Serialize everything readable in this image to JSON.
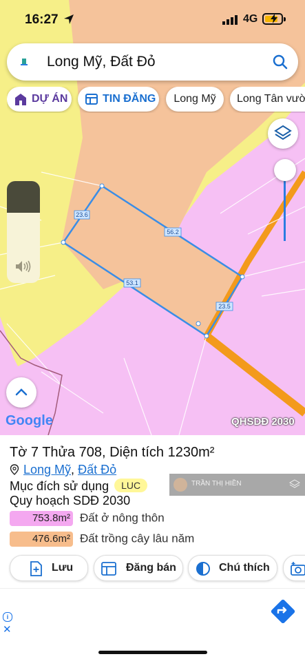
{
  "status": {
    "time": "16:27",
    "network": "4G"
  },
  "search": {
    "query": "Long Mỹ, Đất Đỏ"
  },
  "chips": [
    {
      "label": "DỰ ÁN"
    },
    {
      "label": "TIN ĐĂNG"
    },
    {
      "label": "Long Mỹ"
    },
    {
      "label": "Long Tân vườ"
    }
  ],
  "map": {
    "edge_labels": [
      "23.6",
      "56.2",
      "53.1",
      "23.5"
    ],
    "watermark": "Google",
    "layer_label": "QHSDĐ 2030",
    "colors": {
      "residential": "#f6c0f4",
      "perennial": "#f5c39b",
      "rice": "#f6ef88",
      "road": "#f39a1c",
      "boundary": "#3a8de6"
    }
  },
  "parcel": {
    "title": "Tờ 7 Thửa 708, Diện tích 1230m²",
    "commune": "Long Mỹ",
    "separator": ",",
    "district": "Đất Đỏ",
    "purpose_label": "Mục đích sử dụng",
    "purpose_code": "LUC",
    "plan_label": "Quy hoạch SDĐ 2030",
    "zones": [
      {
        "area": "753.8m²",
        "name": "Đất ở nông thôn"
      },
      {
        "area": "476.6m²",
        "name": "Đất trồng cây lâu năm"
      }
    ]
  },
  "overlay_user": {
    "name": "TRẦN THỊ HIỀN"
  },
  "actions": [
    {
      "label": "Lưu"
    },
    {
      "label": "Đăng bán"
    },
    {
      "label": "Chú thích"
    }
  ]
}
